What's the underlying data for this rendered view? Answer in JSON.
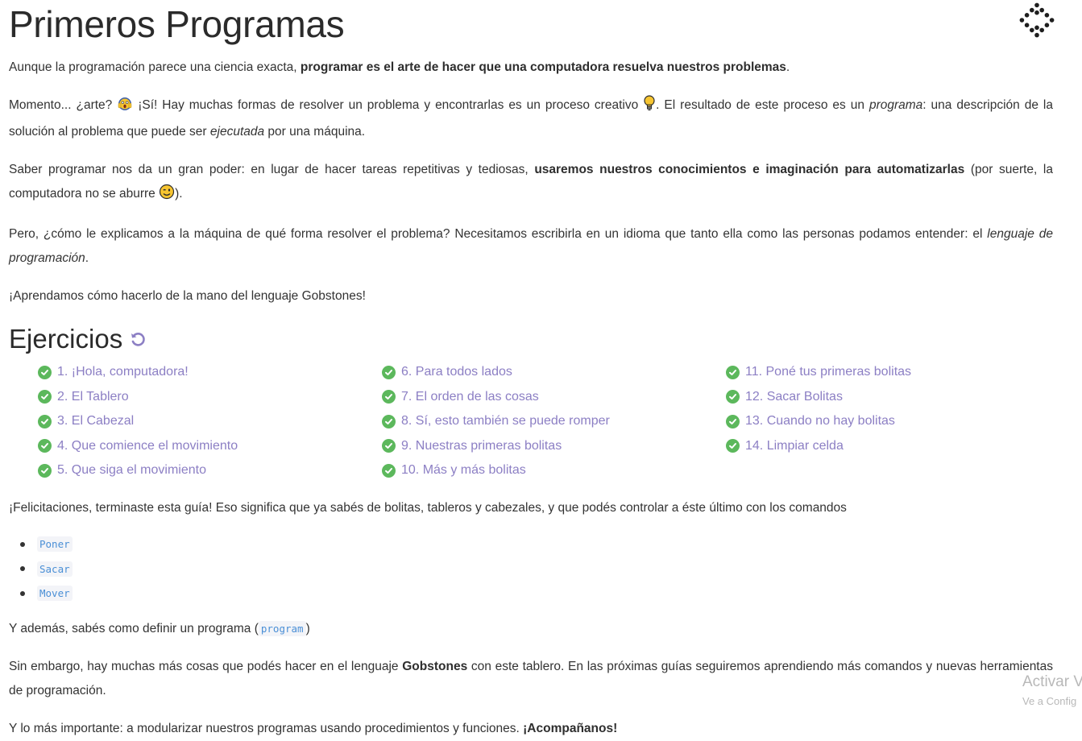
{
  "title": "Primeros Programas",
  "intro": {
    "p1_a": "Aunque la programación parece una ciencia exacta, ",
    "p1_b": "programar es el arte de hacer que una computadora resuelva nuestros problemas",
    "p1_c": ".",
    "p2_a": "Momento... ¿arte? ",
    "p2_b": " ¡Sí! Hay muchas formas de resolver un problema y encontrarlas es un proceso creativo ",
    "p2_c": ". El resultado de este proceso es un ",
    "p2_d": "programa",
    "p2_e": ": una descripción de la solución al problema que puede ser ",
    "p2_f": "ejecutada",
    "p2_g": " por una máquina.",
    "p3_a": "Saber programar nos da un gran poder: en lugar de hacer tareas repetitivas y tediosas, ",
    "p3_b": "usaremos nuestros conocimientos e imaginación para automatizarlas",
    "p3_c": " (por suerte, la computadora no se aburre ",
    "p3_d": ").",
    "p4_a": "Pero, ¿cómo le explicamos a la máquina de qué forma resolver el problema? Necesitamos escribirla en un idioma que tanto ella como las personas podamos entender: el ",
    "p4_b": "lenguaje de programación",
    "p4_c": ".",
    "p5": "¡Aprendamos cómo hacerlo de la mano del lenguaje Gobstones!"
  },
  "exercises": {
    "heading": "Ejercicios",
    "items": [
      "1. ¡Hola, computadora!",
      "2. El Tablero",
      "3. El Cabezal",
      "4. Que comience el movimiento",
      "5. Que siga el movimiento",
      "6. Para todos lados",
      "7. El orden de las cosas",
      "8. Sí, esto también se puede romper",
      "9. Nuestras primeras bolitas",
      "10. Más y más bolitas",
      "11. Poné tus primeras bolitas",
      "12. Sacar Bolitas",
      "13. Cuando no hay bolitas",
      "14. Limpiar celda"
    ]
  },
  "outro": {
    "congrats": "¡Felicitaciones, terminaste esta guía! Eso significa que ya sabés de bolitas, tableros y cabezales, y que podés controlar a éste último con los comandos",
    "commands": [
      "Poner",
      "Sacar",
      "Mover"
    ],
    "define_a": "Y además, sabés como definir un programa (",
    "define_code": "program",
    "define_b": ")",
    "p7_a": "Sin embargo, hay muchas más cosas que podés hacer en el lenguaje ",
    "p7_b": "Gobstones",
    "p7_c": " con este tablero. En las próximas guías seguiremos aprendiendo más comandos y nuevas herramientas de programación.",
    "p8_a": "Y lo más importante: a modularizar nuestros programas usando procedimientos y funciones. ",
    "p8_b": "¡Acompañanos!"
  },
  "watermark": {
    "line1": "Activar V",
    "line2": "Ve a Config"
  },
  "icons": {
    "scream": "screaming-face-emoji",
    "bulb": "light-bulb-emoji",
    "wink": "winking-face-emoji",
    "restart": "restart-icon",
    "check": "check-circle-icon",
    "logo": "gobstones-logo"
  },
  "colors": {
    "link": "#8c7fc4",
    "check": "#5cb85c",
    "code": "#4a8fd6"
  }
}
